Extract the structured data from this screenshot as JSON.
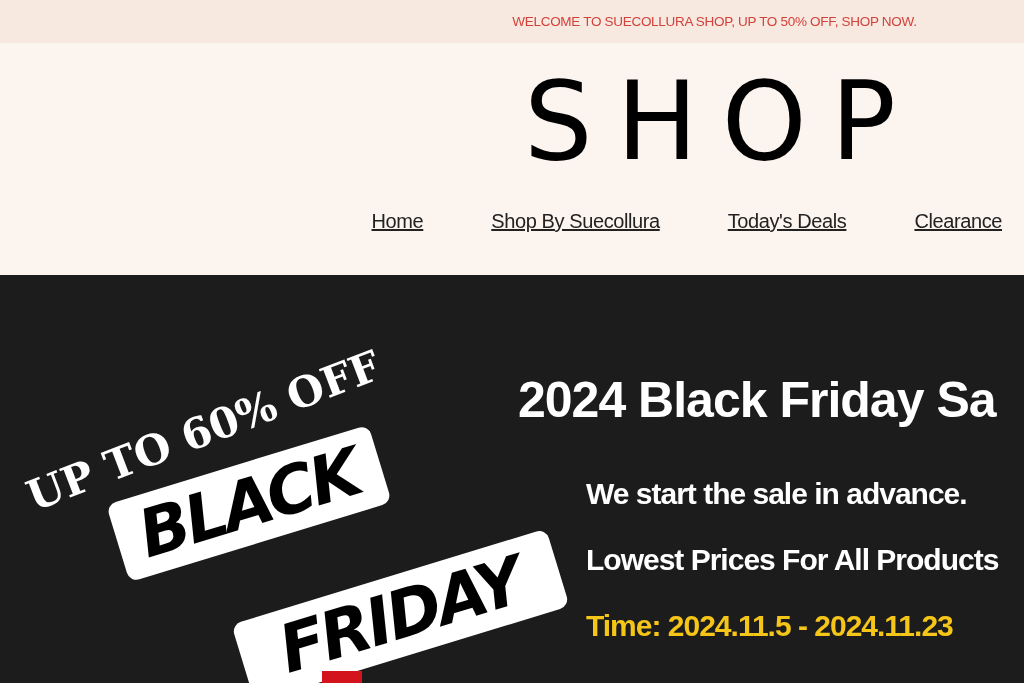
{
  "announcement": "WELCOME TO SUECOLLURA SHOP, UP TO 50% OFF, SHOP NOW.",
  "logo": "SHOP",
  "nav": [
    {
      "label": "Home"
    },
    {
      "label": "Shop By Suecollura"
    },
    {
      "label": "Today's Deals"
    },
    {
      "label": "Clearance"
    }
  ],
  "banner": {
    "badge": "UP TO 60% OFF",
    "signs": [
      "BLACK",
      "FRIDAY"
    ],
    "title": "2024 Black Friday Sa",
    "lines": [
      {
        "text": "We start the sale in advance.",
        "kind": "plain"
      },
      {
        "text": "Lowest Prices For All Products",
        "kind": "plain"
      },
      {
        "text": "Time: 2024.11.5 - 2024.11.23",
        "kind": "highlight"
      }
    ]
  }
}
